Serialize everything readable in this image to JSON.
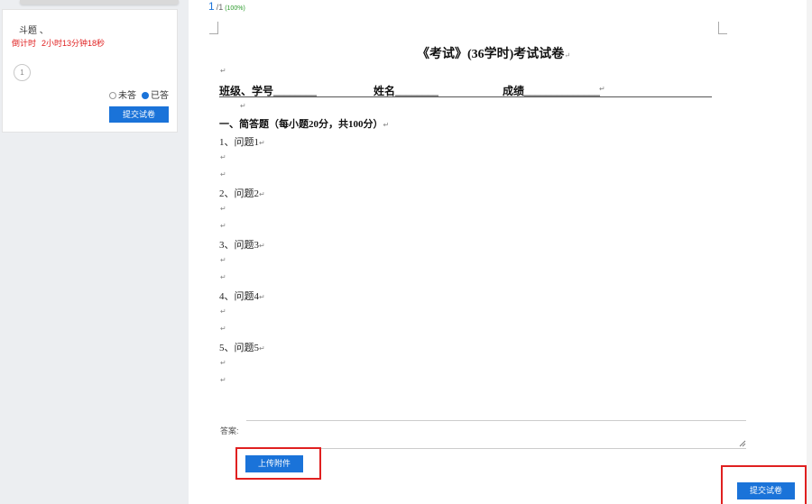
{
  "sidebar": {
    "title": "斗题 、",
    "timer_label": "倒计时",
    "timer_value": "2小时13分钟18秒",
    "question_numbers": [
      "1"
    ],
    "legend_unanswered": "未答",
    "legend_answered": "已答",
    "submit_label": "提交试卷"
  },
  "viewer": {
    "page_current": "1",
    "page_total": "/1",
    "zoom": "(100%)"
  },
  "document": {
    "title": "《考试》(36学时)考试试卷",
    "paragraph_mark": "↵",
    "class_label": "班级、学号________",
    "name_label": "姓名________",
    "score_label": "成绩______________",
    "section_heading": "一、简答题（每小题20分，共100分）",
    "questions": [
      "1、问题1",
      "2、问题2",
      "3、问题3",
      "4、问题4",
      "5、问题5"
    ]
  },
  "answer": {
    "label": "答案:",
    "value": "",
    "upload_label": "上传附件"
  },
  "footer": {
    "submit_label": "提交试卷"
  },
  "colors": {
    "primary": "#1a73d9",
    "highlight_frame": "#e02020",
    "timer": "#e02020"
  }
}
